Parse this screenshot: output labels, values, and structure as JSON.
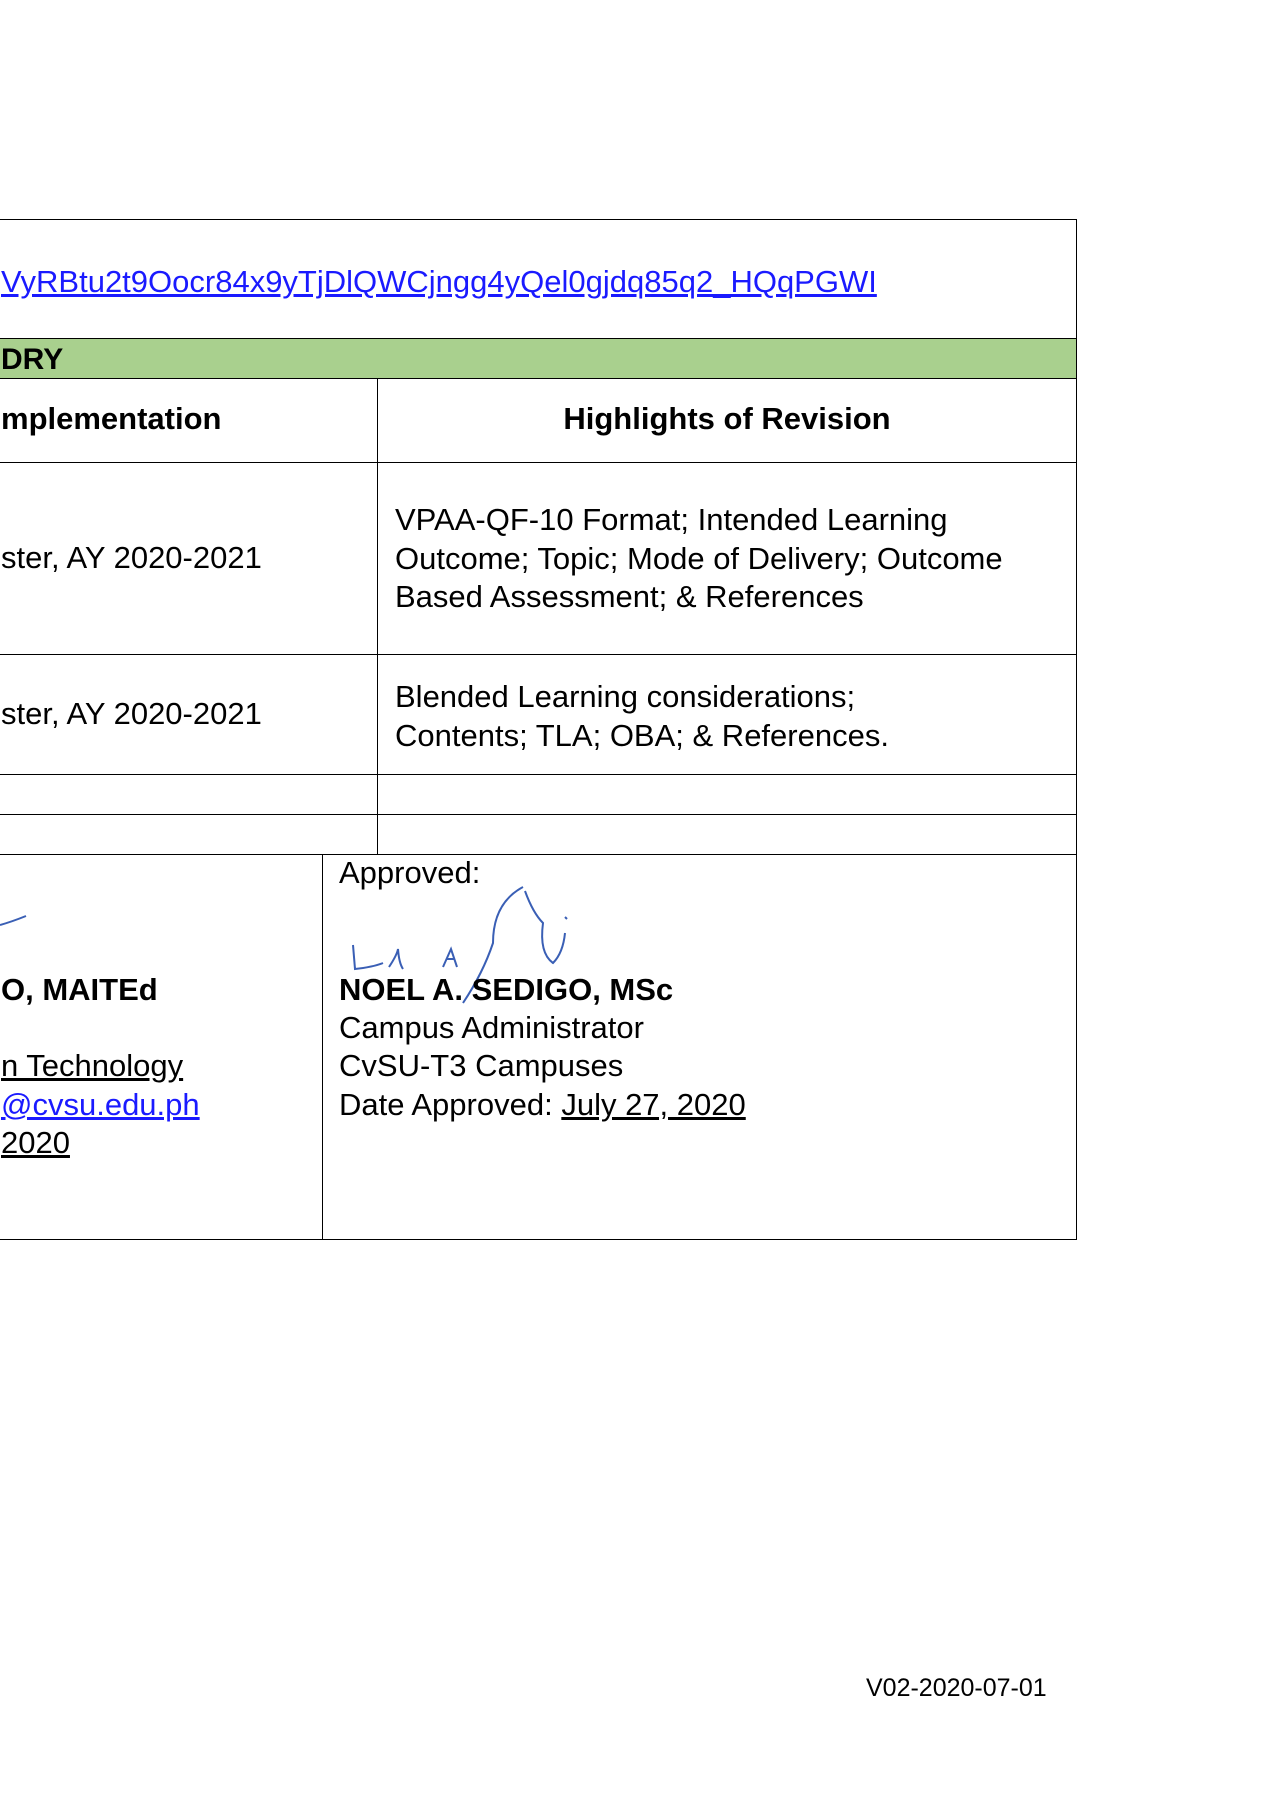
{
  "link_text": "VyRBtu2t9Oocr84x9yTjDlQWCjngg4yQel0gjdq85q2_HQqPGWI",
  "history_title": "DRY",
  "columns": {
    "implementation": "mplementation",
    "highlights": "Highlights of Revision"
  },
  "rows": [
    {
      "semester": "ster, AY 2020-2021",
      "highlights": [
        "VPAA-QF-10 Format; Intended Learning",
        "Outcome; Topic; Mode of Delivery; Outcome",
        "Based Assessment; & References"
      ]
    },
    {
      "semester": "ster, AY 2020-2021",
      "highlights": [
        "Blended Learning considerations;",
        "Contents; TLA; OBA; & References."
      ]
    }
  ],
  "prepared": {
    "name": "O, MAITEd",
    "dept": "n Technology",
    "email": "@cvsu.edu.ph",
    "date": "2020"
  },
  "approved": {
    "label": "Approved:",
    "name": "NOEL A. SEDIGO, MSc",
    "title": "Campus Administrator",
    "campus": "CvSU-T3 Campuses",
    "date_label": "Date Approved: ",
    "date_value": "July 27, 2020"
  },
  "signature_color": "#3a5fb5",
  "version": "V02-2020-07-01"
}
